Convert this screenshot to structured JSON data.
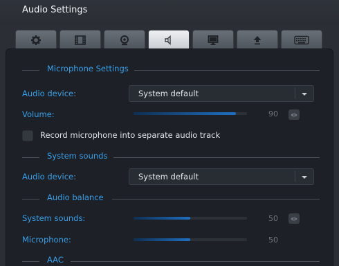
{
  "window": {
    "title": "Audio Settings"
  },
  "tabs": [
    {
      "icon": "gear-icon",
      "active": false
    },
    {
      "icon": "film-icon",
      "active": false
    },
    {
      "icon": "webcam-icon",
      "active": false
    },
    {
      "icon": "speaker-icon",
      "active": true
    },
    {
      "icon": "monitor-icon",
      "active": false
    },
    {
      "icon": "upload-icon",
      "active": false
    },
    {
      "icon": "keyboard-icon",
      "active": false
    }
  ],
  "microphone": {
    "heading": "Microphone Settings",
    "device_label": "Audio device:",
    "device_value": "System default",
    "volume_label": "Volume:",
    "volume_value": "90",
    "volume_level": 0.9,
    "separate_track_label": "Record microphone into separate audio track",
    "separate_track_checked": false
  },
  "system_sounds": {
    "heading": "System sounds",
    "device_label": "Audio device:",
    "device_value": "System default"
  },
  "balance": {
    "heading": "Audio balance",
    "system_label": "System sounds:",
    "system_value": "50",
    "system_level": 0.5,
    "mic_label": "Microphone:",
    "mic_value": "50",
    "mic_level": 0.5
  },
  "aac": {
    "heading": "AAC"
  },
  "colors": {
    "accent": "#3a9ee8",
    "panel": "#1d2127",
    "background": "#2b2f35"
  }
}
